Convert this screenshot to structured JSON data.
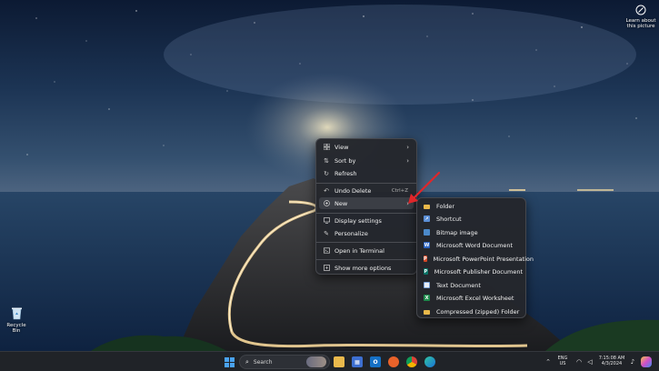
{
  "desktop": {
    "recycle_bin_label": "Recycle Bin",
    "learn_about_label": "Learn about this picture"
  },
  "context_menu": {
    "items": [
      {
        "label": "View",
        "icon": "grid-icon",
        "submenu": true
      },
      {
        "label": "Sort by",
        "icon": "sort-icon",
        "submenu": true
      },
      {
        "label": "Refresh",
        "icon": "refresh-icon"
      },
      {
        "label": "Undo Delete",
        "icon": "undo-icon",
        "shortcut": "Ctrl+Z"
      },
      {
        "label": "New",
        "icon": "new-icon",
        "submenu": true,
        "highlighted": true
      },
      {
        "label": "Display settings",
        "icon": "display-icon"
      },
      {
        "label": "Personalize",
        "icon": "brush-icon"
      },
      {
        "label": "Open in Terminal",
        "icon": "terminal-icon"
      },
      {
        "label": "Show more options",
        "icon": "more-options-icon"
      }
    ]
  },
  "new_submenu": {
    "items": [
      {
        "label": "Folder",
        "icon": "folder-icon",
        "color": "#e8b84a"
      },
      {
        "label": "Shortcut",
        "icon": "shortcut-icon",
        "color": "#5b8fd6"
      },
      {
        "label": "Bitmap image",
        "icon": "bitmap-icon",
        "color": "#4b89c9"
      },
      {
        "label": "Microsoft Word Document",
        "icon": "word-icon",
        "color": "#2b63c0"
      },
      {
        "label": "Microsoft PowerPoint Presentation",
        "icon": "powerpoint-icon",
        "color": "#d24726"
      },
      {
        "label": "Microsoft Publisher Document",
        "icon": "publisher-icon",
        "color": "#077568"
      },
      {
        "label": "Text Document",
        "icon": "text-document-icon",
        "color": "#7aa3d8"
      },
      {
        "label": "Microsoft Excel Worksheet",
        "icon": "excel-icon",
        "color": "#1e8a4c"
      },
      {
        "label": "Compressed (zipped) Folder",
        "icon": "zip-folder-icon",
        "color": "#e8b84a"
      }
    ]
  },
  "taskbar": {
    "search_placeholder": "Search",
    "language": "ENG",
    "region": "US",
    "time": "7:15:08 AM",
    "date": "4/3/2024"
  },
  "colors": {
    "menu_bg": "#24262c",
    "taskbar_bg": "#202328",
    "annotation_arrow": "#e0262a"
  }
}
